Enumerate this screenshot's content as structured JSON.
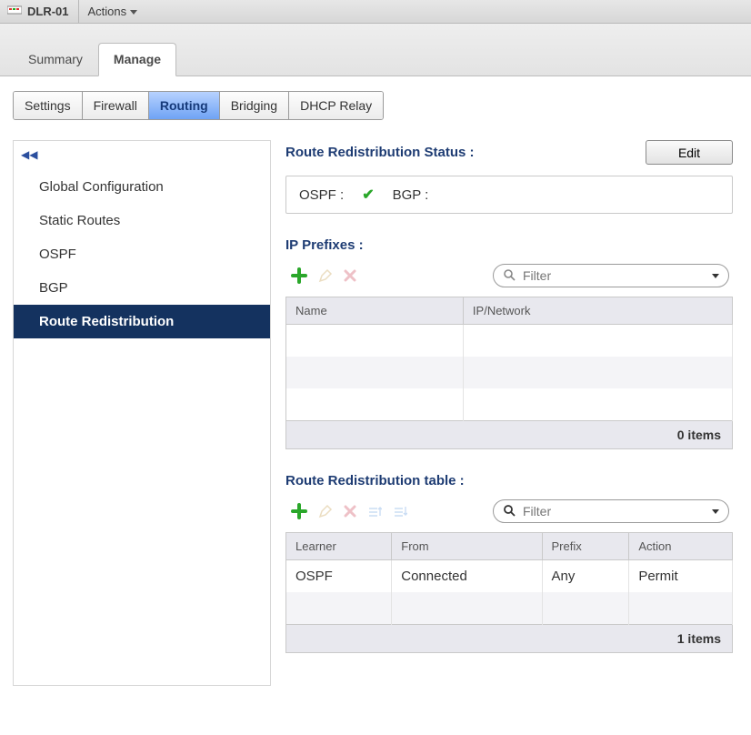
{
  "titlebar": {
    "name": "DLR-01",
    "actions_label": "Actions"
  },
  "primary_tabs": [
    {
      "label": "Summary",
      "active": false
    },
    {
      "label": "Manage",
      "active": true
    }
  ],
  "sub_tabs": [
    {
      "label": "Settings",
      "active": false
    },
    {
      "label": "Firewall",
      "active": false
    },
    {
      "label": "Routing",
      "active": true
    },
    {
      "label": "Bridging",
      "active": false
    },
    {
      "label": "DHCP Relay",
      "active": false
    }
  ],
  "sidebar": {
    "items": [
      {
        "label": "Global Configuration",
        "selected": false
      },
      {
        "label": "Static Routes",
        "selected": false
      },
      {
        "label": "OSPF",
        "selected": false
      },
      {
        "label": "BGP",
        "selected": false
      },
      {
        "label": "Route Redistribution",
        "selected": true
      }
    ]
  },
  "main": {
    "status_title": "Route Redistribution Status :",
    "edit_label": "Edit",
    "protocols": {
      "ospf_label": "OSPF :",
      "ospf_enabled": true,
      "bgp_label": "BGP :",
      "bgp_enabled": false
    },
    "ip_prefixes": {
      "title": "IP Prefixes :",
      "filter_placeholder": "Filter",
      "columns": [
        "Name",
        "IP/Network"
      ],
      "rows": [],
      "footer": "0 items"
    },
    "redistribution_table": {
      "title": "Route Redistribution table :",
      "filter_placeholder": "Filter",
      "columns": [
        "Learner",
        "From",
        "Prefix",
        "Action"
      ],
      "rows": [
        {
          "learner": "OSPF",
          "from": "Connected",
          "prefix": "Any",
          "action": "Permit"
        }
      ],
      "footer": "1 items"
    }
  }
}
